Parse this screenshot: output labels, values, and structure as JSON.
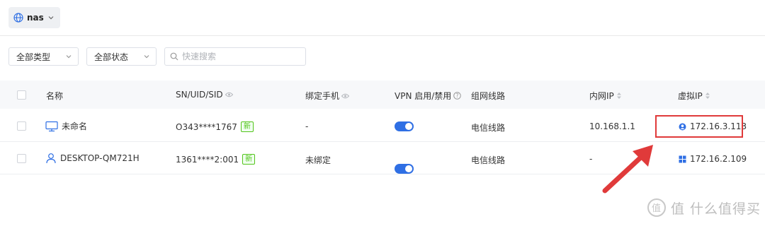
{
  "network": {
    "name": "nas",
    "icon": "globe-icon"
  },
  "filters": {
    "type_select": "全部类型",
    "status_select": "全部状态",
    "search_placeholder": "快速搜索"
  },
  "table": {
    "headers": [
      "名称",
      "SN/UID/SID",
      "绑定手机",
      "VPN 启用/禁用",
      "组网线路",
      "内网IP",
      "虚拟IP"
    ],
    "rows": [
      {
        "name": "未命名",
        "device_icon": "desktop-icon",
        "sn": "O343****1767",
        "badge": "新",
        "phone": "-",
        "vpn_enabled": true,
        "line": "电信线路",
        "lan_ip": "10.168.1.1",
        "virtual_ip": "172.16.3.113",
        "os_icon": "macos-icon"
      },
      {
        "name": "DESKTOP-QM721H",
        "device_icon": "user-icon",
        "sn": "1361****2:001",
        "badge": "新",
        "phone": "未绑定",
        "vpn_enabled": true,
        "line": "电信线路",
        "lan_ip": "-",
        "virtual_ip": "172.16.2.109",
        "os_icon": "windows-icon"
      }
    ]
  },
  "colors": {
    "accent": "#2f6fe4",
    "highlight": "#e03a3a",
    "badge": "#52c41a"
  },
  "watermark": "值 什么值得买"
}
